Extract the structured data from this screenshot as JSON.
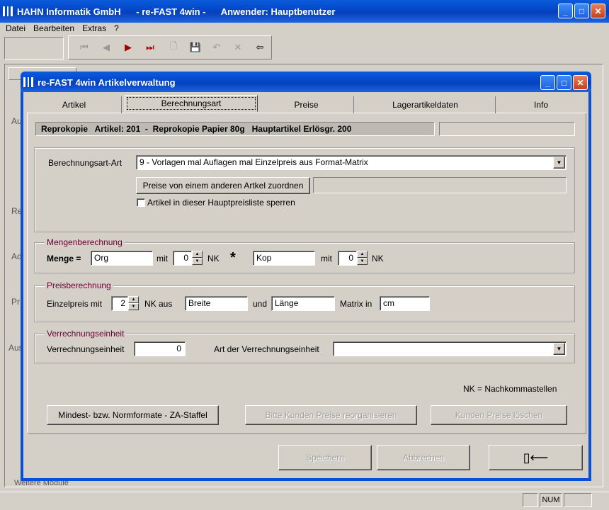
{
  "app": {
    "title": "HAHN Informatik GmbH      - re-FAST 4win -      Anwender: Hauptbenutzer",
    "menu": [
      "Datei",
      "Bearbeiten",
      "Extras",
      "?"
    ],
    "status_num": "NUM",
    "bg_left_labels": [
      "Au",
      "Re",
      "Ad",
      "Pr",
      "Aus"
    ],
    "bg_bottom_label": "Weitere Module"
  },
  "dialog": {
    "title": "re-FAST 4win Artikelverwaltung",
    "tabs": [
      "Artikel",
      "Berechnungsart",
      "Preise",
      "Lagerartikeldaten",
      "Info"
    ],
    "header_text": "Reprokopie   Artikel: 201  -  Reprokopie Papier 80g   Hauptartikel Erlösgr. 200",
    "calc_type_label": "Berechnungsart-Art",
    "calc_type_value": "9 - Vorlagen mal Auflagen mal Einzelpreis aus Format-Matrix",
    "assign_prices_button": "Preise von einem anderen Artkel zuordnen",
    "lock_checkbox_label": "Artikel in dieser Hauptpreisliste sperren",
    "mengen": {
      "legend": "Mengenberechnung",
      "label": "Menge =",
      "field1": "Org",
      "mit1": "mit",
      "nk1": "0",
      "nk_label1": "NK",
      "star": "*",
      "field2": "Kop",
      "mit2": "mit",
      "nk2": "0",
      "nk_label2": "NK"
    },
    "preis": {
      "legend": "Preisberechnung",
      "label": "Einzelpreis mit",
      "nk": "2",
      "nk_aus": "NK aus",
      "field1": "Breite",
      "und": "und",
      "field2": "Länge",
      "matrix_label": "Matrix in",
      "matrix_value": "cm"
    },
    "verrechnung": {
      "legend": "Verrechnungseinheit",
      "label": "Verrechnungseinheit",
      "value": "0",
      "art_label": "Art der Verrechnungseinheit",
      "art_value": ""
    },
    "nk_note": "NK = Nachkommastellen",
    "btn_formats": "Mindest- bzw. Normformate - ZA-Staffel",
    "btn_reorg": "Bitte Kunden Preise reorganisieren",
    "btn_delete": "Kunden Preise löschen",
    "btn_save": "Speichern",
    "btn_cancel": "Abbrechen"
  }
}
